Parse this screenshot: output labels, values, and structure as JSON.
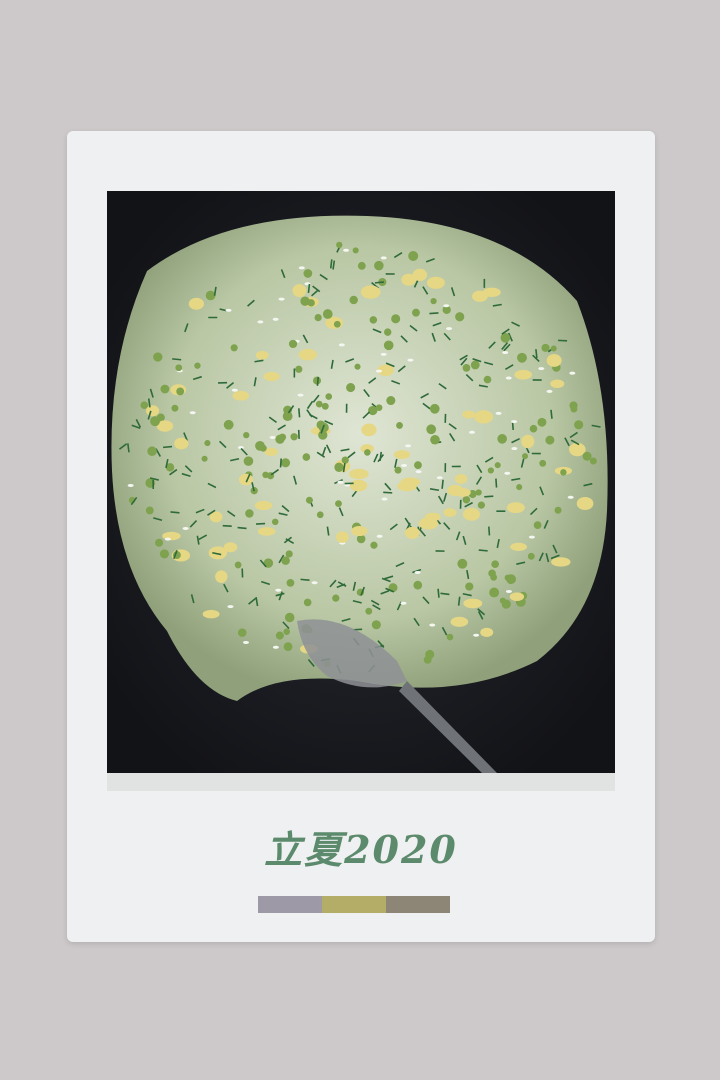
{
  "caption": "立夏2020",
  "swatches": [
    {
      "name": "swatch-gray",
      "color": "#9d99a6"
    },
    {
      "name": "swatch-olive",
      "color": "#b4ad68"
    },
    {
      "name": "swatch-taupe",
      "color": "#8d8677"
    }
  ],
  "colors": {
    "background": "#cdc9ca",
    "card": "#eff0f1",
    "caption": "#5c8a6c",
    "wok": "#1c1d22"
  },
  "photo": {
    "subject": "fried-rice-with-peas-and-chives-in-wok"
  }
}
